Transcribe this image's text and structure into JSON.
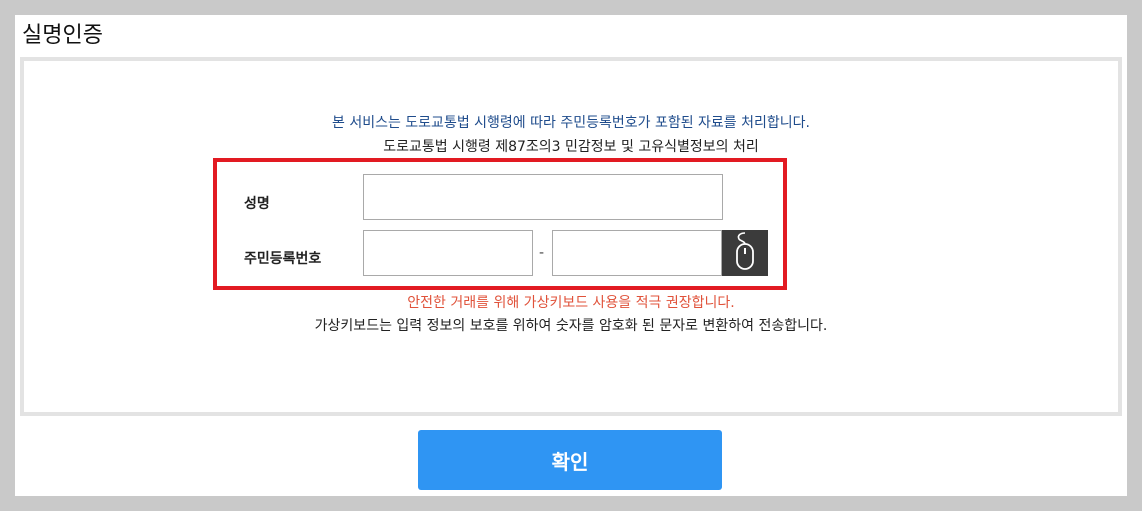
{
  "page": {
    "title": "실명인증"
  },
  "notices": {
    "service_notice": "본 서비스는 도로교통법 시행령에 따라 주민등록번호가 포함된 자료를 처리합니다.",
    "law_notice": "도로교통법 시행령 제87조의3 민감정보 및 고유식별정보의 처리",
    "keyboard_recommend": "안전한 거래를 위해 가상키보드 사용을 적극 권장합니다.",
    "keyboard_info": "가상키보드는 입력 정보의 보호를 위하여 숫자를 암호화 된 문자로 변환하여 전송합니다."
  },
  "form": {
    "name_label": "성명",
    "name_value": "",
    "rrn_label": "주민등록번호",
    "rrn_first_value": "",
    "rrn_second_value": "",
    "rrn_separator": "-",
    "virtual_keyboard_icon": "mouse-icon"
  },
  "actions": {
    "confirm_label": "확인"
  },
  "colors": {
    "highlight_border": "#e21a22",
    "notice_blue": "#1f4c8c",
    "notice_red": "#e0523a",
    "confirm_button": "#2f95f3",
    "keyboard_button": "#3b3b3b"
  }
}
